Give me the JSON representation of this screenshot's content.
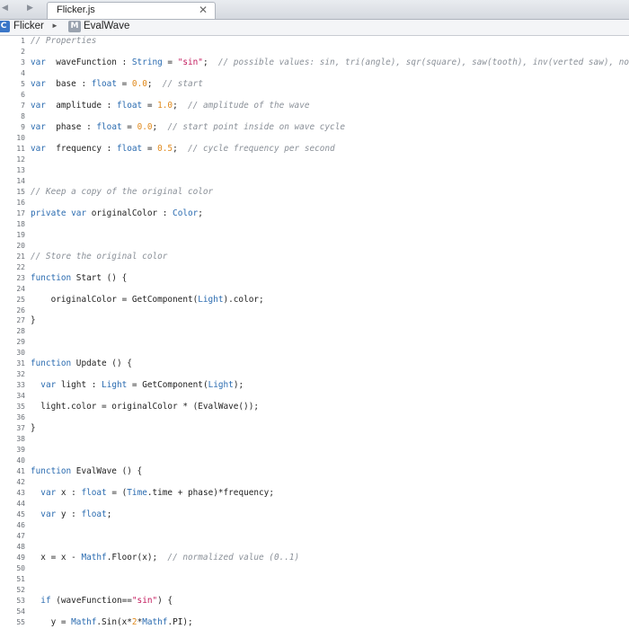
{
  "tabbar": {
    "back_arrow": "◀",
    "forward_arrow": "▶",
    "tab_title": "Flicker.js",
    "close_glyph": "✕"
  },
  "breadcrumb": {
    "class_icon": "C",
    "class_name": "Flicker",
    "separator": "►",
    "method_icon": "M",
    "method_name": "EvalWave"
  },
  "colors": {
    "keyword": "#2a6bb0",
    "string": "#c2185b",
    "number": "#e08a1e",
    "comment": "#8a9098"
  },
  "code_lines": [
    {
      "n": "1",
      "t": [
        [
          "cm",
          "// Properties"
        ]
      ]
    },
    {
      "n": "2",
      "t": []
    },
    {
      "n": "3",
      "t": [
        [
          "kw",
          "var"
        ],
        [
          "",
          "  waveFunction : "
        ],
        [
          "ty",
          "String"
        ],
        [
          "",
          " = "
        ],
        [
          "str",
          "\"sin\""
        ],
        [
          "",
          ";  "
        ],
        [
          "cm",
          "// possible values: sin, tri(angle), sqr(square), saw(tooth), inv(verted saw), noise (random)"
        ]
      ]
    },
    {
      "n": "4",
      "t": []
    },
    {
      "n": "5",
      "t": [
        [
          "kw",
          "var"
        ],
        [
          "",
          "  base : "
        ],
        [
          "ty",
          "float"
        ],
        [
          "",
          " = "
        ],
        [
          "num",
          "0.0"
        ],
        [
          "",
          ";  "
        ],
        [
          "cm",
          "// start"
        ]
      ]
    },
    {
      "n": "6",
      "t": []
    },
    {
      "n": "7",
      "t": [
        [
          "kw",
          "var"
        ],
        [
          "",
          "  amplitude : "
        ],
        [
          "ty",
          "float"
        ],
        [
          "",
          " = "
        ],
        [
          "num",
          "1.0"
        ],
        [
          "",
          ";  "
        ],
        [
          "cm",
          "// amplitude of the wave"
        ]
      ]
    },
    {
      "n": "8",
      "t": []
    },
    {
      "n": "9",
      "t": [
        [
          "kw",
          "var"
        ],
        [
          "",
          "  phase : "
        ],
        [
          "ty",
          "float"
        ],
        [
          "",
          " = "
        ],
        [
          "num",
          "0.0"
        ],
        [
          "",
          ";  "
        ],
        [
          "cm",
          "// start point inside on wave cycle"
        ]
      ]
    },
    {
      "n": "10",
      "t": []
    },
    {
      "n": "11",
      "t": [
        [
          "kw",
          "var"
        ],
        [
          "",
          "  frequency : "
        ],
        [
          "ty",
          "float"
        ],
        [
          "",
          " = "
        ],
        [
          "num",
          "0.5"
        ],
        [
          "",
          ";  "
        ],
        [
          "cm",
          "// cycle frequency per second"
        ]
      ]
    },
    {
      "n": "12",
      "t": []
    },
    {
      "n": "13",
      "t": []
    },
    {
      "n": "14",
      "t": []
    },
    {
      "n": "15",
      "t": [
        [
          "cm",
          "// Keep a copy of the original color"
        ]
      ]
    },
    {
      "n": "16",
      "t": []
    },
    {
      "n": "17",
      "t": [
        [
          "kw",
          "private var"
        ],
        [
          "",
          " originalColor : "
        ],
        [
          "ty",
          "Color"
        ],
        [
          "",
          ";"
        ]
      ]
    },
    {
      "n": "18",
      "t": []
    },
    {
      "n": "19",
      "t": []
    },
    {
      "n": "20",
      "t": []
    },
    {
      "n": "21",
      "t": [
        [
          "cm",
          "// Store the original color"
        ]
      ]
    },
    {
      "n": "22",
      "t": []
    },
    {
      "n": "23",
      "t": [
        [
          "kw",
          "function"
        ],
        [
          "",
          " Start () {"
        ]
      ]
    },
    {
      "n": "24",
      "t": []
    },
    {
      "n": "25",
      "t": [
        [
          "",
          "    originalColor = GetComponent("
        ],
        [
          "ty",
          "Light"
        ],
        [
          "",
          ").color;"
        ]
      ]
    },
    {
      "n": "26",
      "t": []
    },
    {
      "n": "27",
      "t": [
        [
          "",
          "}"
        ]
      ]
    },
    {
      "n": "28",
      "t": []
    },
    {
      "n": "29",
      "t": []
    },
    {
      "n": "30",
      "t": []
    },
    {
      "n": "31",
      "t": [
        [
          "kw",
          "function"
        ],
        [
          "",
          " Update () {"
        ]
      ]
    },
    {
      "n": "32",
      "t": []
    },
    {
      "n": "33",
      "t": [
        [
          "",
          "  "
        ],
        [
          "kw",
          "var"
        ],
        [
          "",
          " light : "
        ],
        [
          "ty",
          "Light"
        ],
        [
          "",
          " = GetComponent("
        ],
        [
          "ty",
          "Light"
        ],
        [
          "",
          ");"
        ]
      ]
    },
    {
      "n": "34",
      "t": []
    },
    {
      "n": "35",
      "t": [
        [
          "",
          "  light.color = originalColor * (EvalWave());"
        ]
      ]
    },
    {
      "n": "36",
      "t": []
    },
    {
      "n": "37",
      "t": [
        [
          "",
          "}"
        ]
      ]
    },
    {
      "n": "38",
      "t": []
    },
    {
      "n": "39",
      "t": []
    },
    {
      "n": "40",
      "t": []
    },
    {
      "n": "41",
      "t": [
        [
          "kw",
          "function"
        ],
        [
          "",
          " EvalWave () {"
        ]
      ]
    },
    {
      "n": "42",
      "t": []
    },
    {
      "n": "43",
      "t": [
        [
          "",
          "  "
        ],
        [
          "kw",
          "var"
        ],
        [
          "",
          " x : "
        ],
        [
          "ty",
          "float"
        ],
        [
          "",
          " = ("
        ],
        [
          "ty",
          "Time"
        ],
        [
          "",
          ".time + phase)*frequency;"
        ]
      ]
    },
    {
      "n": "44",
      "t": []
    },
    {
      "n": "45",
      "t": [
        [
          "",
          "  "
        ],
        [
          "kw",
          "var"
        ],
        [
          "",
          " y : "
        ],
        [
          "ty",
          "float"
        ],
        [
          "",
          ";"
        ]
      ]
    },
    {
      "n": "46",
      "t": []
    },
    {
      "n": "47",
      "t": []
    },
    {
      "n": "48",
      "t": []
    },
    {
      "n": "49",
      "t": [
        [
          "",
          "  x = x - "
        ],
        [
          "ty",
          "Mathf"
        ],
        [
          "",
          ".Floor(x);  "
        ],
        [
          "cm",
          "// normalized value (0..1)"
        ]
      ]
    },
    {
      "n": "50",
      "t": []
    },
    {
      "n": "51",
      "t": []
    },
    {
      "n": "52",
      "t": []
    },
    {
      "n": "53",
      "t": [
        [
          "",
          "  "
        ],
        [
          "kw",
          "if"
        ],
        [
          "",
          " (waveFunction=="
        ],
        [
          "str",
          "\"sin\""
        ],
        [
          "",
          ") {"
        ]
      ]
    },
    {
      "n": "54",
      "t": []
    },
    {
      "n": "55",
      "t": [
        [
          "",
          "    y = "
        ],
        [
          "ty",
          "Mathf"
        ],
        [
          "",
          ".Sin(x*"
        ],
        [
          "num",
          "2"
        ],
        [
          "",
          "*"
        ],
        [
          "ty",
          "Mathf"
        ],
        [
          "",
          ".PI);"
        ]
      ]
    }
  ]
}
